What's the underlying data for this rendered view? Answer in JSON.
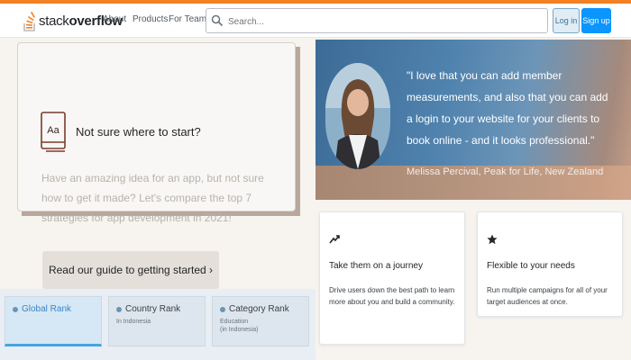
{
  "header": {
    "logo_text_light": "stack",
    "logo_text_bold": "overflow",
    "nav": [
      "About",
      "Products",
      "For Teams"
    ],
    "search_placeholder": "Search...",
    "login_label": "Log in",
    "signup_label": "Sign up"
  },
  "card": {
    "icon_label": "Aa",
    "title": "Not sure where to start?",
    "body": "Have an amazing idea for an app, but not sure how to get it made? Let's compare the top 7 strategies for app development in 2021!",
    "button_label": "Read our guide to getting started ›"
  },
  "ranks": [
    {
      "title": "Global Rank",
      "sub1": "",
      "sub2": ""
    },
    {
      "title": "Country Rank",
      "sub1": "In Indonesia",
      "sub2": ""
    },
    {
      "title": "Category Rank",
      "sub1": "Education",
      "sub2": "(in Indonesia)"
    }
  ],
  "testimonial": {
    "quote": "\"I love that you can add member measurements, and also that you can add a login to your website for your clients to book online - and it looks professional.\"",
    "author": "Melissa Percival, Peak for Life, New Zealand"
  },
  "features": [
    {
      "icon": "trend-arrow-icon",
      "title": "Take them on a journey",
      "desc": "Drive users down the best path to learn more about you and build a community."
    },
    {
      "icon": "star-icon",
      "title": "Flexible to your needs",
      "desc": "Run multiple campaigns for all of your target audiences at once."
    }
  ],
  "colors": {
    "accent": "#f48024",
    "primary": "#0a95ff",
    "rank_active": "#4aa3df"
  }
}
